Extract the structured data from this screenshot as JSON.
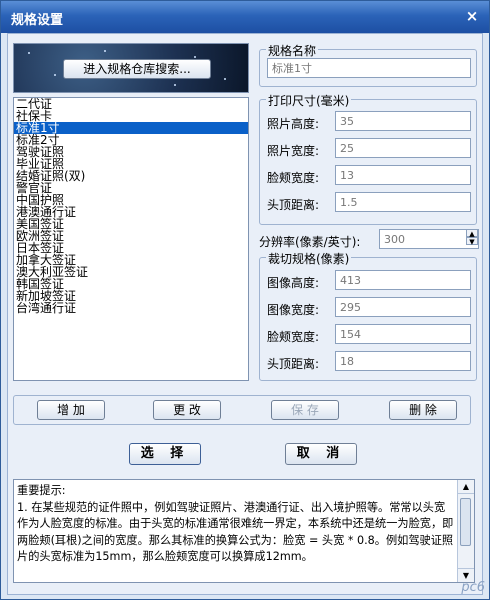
{
  "window": {
    "title": "规格设置",
    "close": "×"
  },
  "warehouse_button": "进入规格仓库搜索...",
  "spec_list": [
    "二代证",
    "社保卡",
    "标准1寸",
    "标准2寸",
    "驾驶证照",
    "毕业证照",
    "结婚证照(双)",
    "警官证",
    "中国护照",
    "港澳通行证",
    "美国签证",
    "欧洲签证",
    "日本签证",
    "加拿大签证",
    "澳大利亚签证",
    "韩国签证",
    "新加坡签证",
    "台湾通行证"
  ],
  "selected_index": 2,
  "spec_name": {
    "legend": "规格名称",
    "value": "标准1寸"
  },
  "print_size": {
    "legend": "打印尺寸(毫米)",
    "fields": [
      {
        "label": "照片高度:",
        "value": "35"
      },
      {
        "label": "照片宽度:",
        "value": "25"
      },
      {
        "label": "脸颊宽度:",
        "value": "13"
      },
      {
        "label": "头顶距离:",
        "value": "1.5"
      }
    ]
  },
  "resolution": {
    "label": "分辨率(像素/英寸):",
    "value": "300"
  },
  "crop_size": {
    "legend": "裁切规格(像素)",
    "fields": [
      {
        "label": "图像高度:",
        "value": "413"
      },
      {
        "label": "图像宽度:",
        "value": "295"
      },
      {
        "label": "脸颊宽度:",
        "value": "154"
      },
      {
        "label": "头顶距离:",
        "value": "18"
      }
    ]
  },
  "actions": {
    "add": "增 加",
    "edit": "更 改",
    "save": "保 存",
    "delete": "删 除"
  },
  "choose": "选 择",
  "cancel": "取 消",
  "notes": "重要提示:\n1. 在某些规范的证件照中，例如驾驶证照片、港澳通行证、出入境护照等。常常以头宽作为人脸宽度的标准。由于头宽的标准通常很难统一界定，本系统中还是统一为脸宽，即两脸颊(耳根)之间的宽度。那么其标准的换算公式为：脸宽 = 头宽 * 0.8。例如驾驶证照片的头宽标准为15mm，那么脸颊宽度可以换算成12mm。",
  "watermark": "pc6"
}
